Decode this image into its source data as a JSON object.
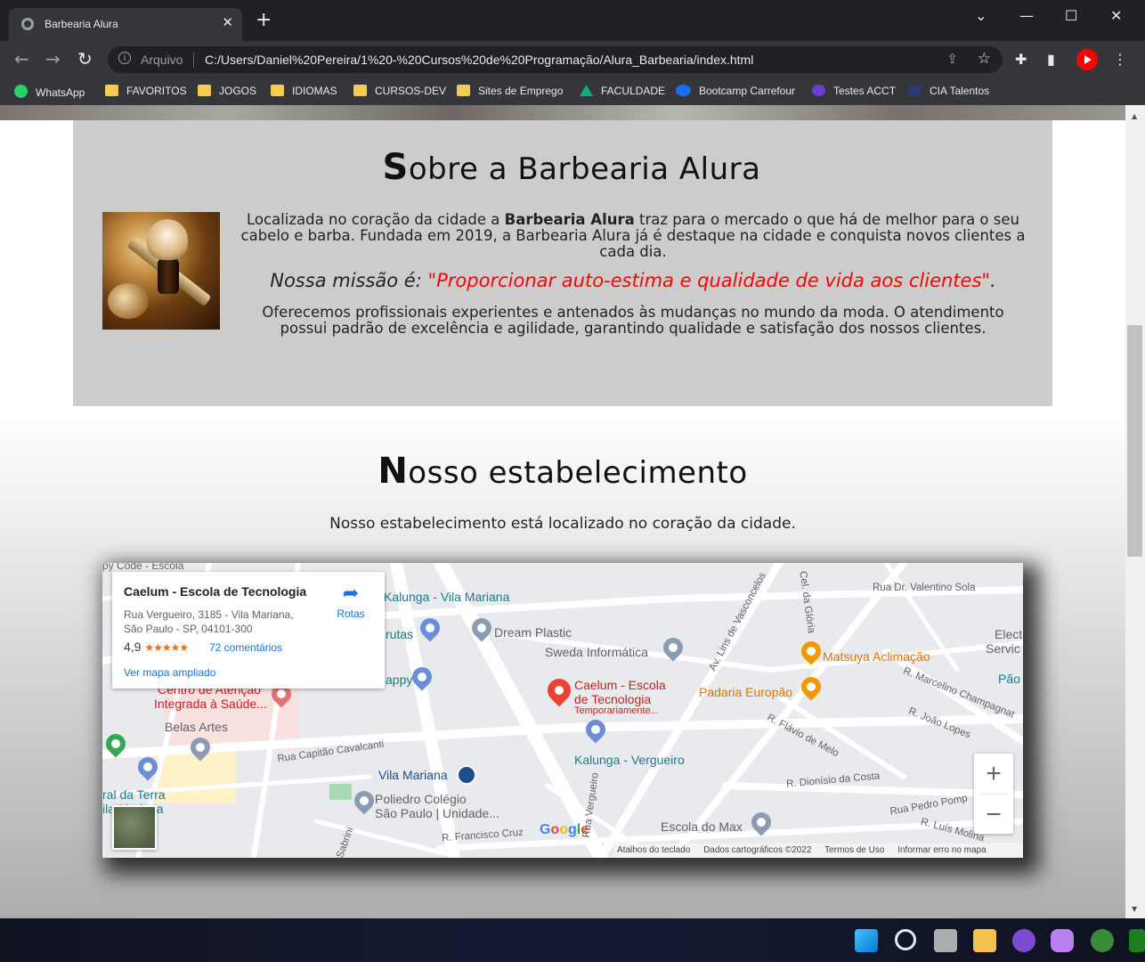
{
  "browser": {
    "tab_title": "Barbearia Alura",
    "tab_close": "✕",
    "new_tab": "+",
    "window_controls": {
      "minimize": "—",
      "maximize": "☐",
      "close": "✕",
      "tab_search": "⌄"
    },
    "nav": {
      "back": "←",
      "forward": "→",
      "reload": "↻"
    },
    "omnibox": {
      "scheme_label": "Arquivo",
      "url": "C:/Users/Daniel%20Pereira/1%20-%20Cursos%20de%20Programação/Alura_Barbearia/index.html"
    },
    "bookmarks": [
      {
        "label": "WhatsApp",
        "icon": "whatsapp-icon"
      },
      {
        "label": "FAVORITOS",
        "icon": "folder-icon"
      },
      {
        "label": "JOGOS",
        "icon": "folder-icon"
      },
      {
        "label": "IDIOMAS",
        "icon": "folder-icon"
      },
      {
        "label": "CURSOS-DEV",
        "icon": "folder-icon"
      },
      {
        "label": "Sites de Emprego",
        "icon": "folder-icon"
      },
      {
        "label": "FACULDADE",
        "icon": "faculdade-icon"
      },
      {
        "label": "Bootcamp Carrefour",
        "icon": "bootcamp-icon"
      },
      {
        "label": "Testes ACCT",
        "icon": "k-icon"
      },
      {
        "label": "CIA Talentos",
        "icon": "cia-icon"
      }
    ]
  },
  "about": {
    "title_first": "S",
    "title_rest": "obre a Barbearia Alura",
    "p1_before": "Localizada no coração da cidade a ",
    "p1_bold": "Barbearia Alura",
    "p1_after": " traz para o mercado o que há de melhor para o seu cabelo e barba. Fundada em 2019, a Barbearia Alura já é destaque na cidade e conquista novos clientes a cada dia.",
    "mission_label": "Nossa missão é: ",
    "mission_quote": "\"Proporcionar auto-estima e qualidade de vida aos clientes\"",
    "mission_end": ".",
    "p3": "Oferecemos profissionais experientes e antenados às mudanças no mundo da moda. O atendimento possui padrão de excelência e agilidade, garantindo qualidade e satisfação dos nossos clientes."
  },
  "establishment": {
    "title_first": "N",
    "title_rest": "osso estabelecimento",
    "text": "Nosso estabelecimento está localizado no coração da cidade."
  },
  "map": {
    "card": {
      "title": "Caelum - Escola de Tecnologia",
      "address": "Rua Vergueiro, 3185 - Vila Mariana, São Paulo - SP, 04101-300",
      "rating": "4,9",
      "stars": "★★★★★",
      "reviews": "72 comentários",
      "larger_map": "Ver mapa ampliado",
      "directions": "Rotas"
    },
    "places": {
      "kalunga_vm": "Kalunga - Vila Mariana",
      "dream_plastic": "Dream Plastic",
      "sweda": "Sweda Informática",
      "caelum_l1": "Caelum - Escola",
      "caelum_l2": "de Tecnologia",
      "caelum_l3": "Temporariamente...",
      "matsuya": "Matsuya Aclimação",
      "padaria": "Padaria Europão",
      "centro_l1": "Centro de Atenção",
      "centro_l2": "Integrada à Saúde...",
      "belas_artes": "Belas Artes",
      "kalunga_verg": "Kalunga - Vergueiro",
      "vila_mariana": "Vila Mariana",
      "poliedro_l1": "Poliedro Colégio",
      "poliedro_l2": "São Paulo | Unidade...",
      "escola_max": "Escola do Max",
      "elect_l1": "Elect",
      "elect_l2": "Servic",
      "pao": "Pão",
      "terra_l1": "ral da Terra",
      "terra_l2": "ila Mariana",
      "rutas": "rutas",
      "appy": "appy",
      "py_code": "py Code - Escola"
    },
    "streets": {
      "valentino": "Rua Dr. Valentino Sola",
      "lins": "Av. Lins de Vasconcelos",
      "gloria": "Cel. da Glória",
      "marcelino": "R. Marcelino Champagnat",
      "joao_lopes": "R. João Lopes",
      "flavio": "R. Flávio de Melo",
      "capitao": "Rua Capitão Cavalcanti",
      "dionisio": "R. Dionísio da Costa",
      "pedro_pomp": "Rua Pedro Pomp",
      "luis_molina": "R. Luís Molina",
      "francisco_cruz": "R. Francisco Cruz",
      "vergueiro": "Rua Vergueiro",
      "sabrini": "Sabrini"
    },
    "zoom_in": "+",
    "zoom_out": "−",
    "google": "Google",
    "attribution": {
      "shortcuts": "Atalhos do teclado",
      "map_data": "Dados cartográficos ©2022",
      "terms": "Termos de Uso",
      "report": "Informar erro no mapa"
    }
  },
  "scrollbar": {
    "up": "▲",
    "down": "▼"
  },
  "colors": {
    "accent_red": "#ff0000",
    "section_bg": "#cccccc",
    "chrome_dark": "#202124",
    "chrome_toolbar": "#35363a"
  }
}
